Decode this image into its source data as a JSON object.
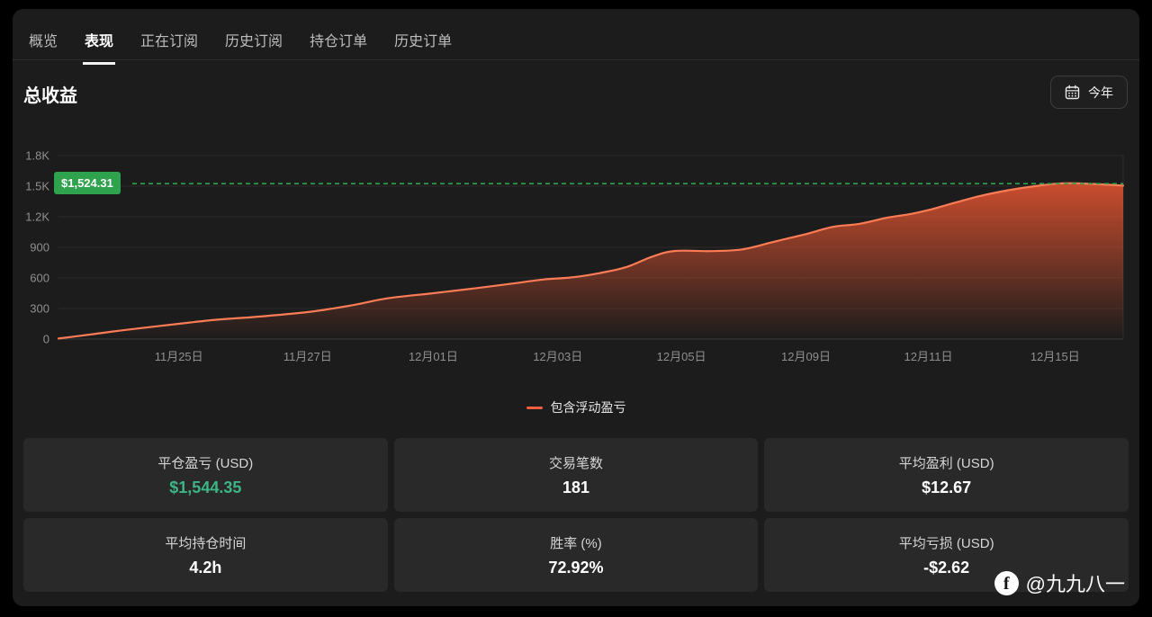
{
  "tabs": {
    "items": [
      {
        "label": "概览",
        "active": false
      },
      {
        "label": "表现",
        "active": true
      },
      {
        "label": "正在订阅",
        "active": false
      },
      {
        "label": "历史订阅",
        "active": false
      },
      {
        "label": "持仓订单",
        "active": false
      },
      {
        "label": "历史订单",
        "active": false
      }
    ]
  },
  "header": {
    "title": "总收益",
    "range_button": "今年"
  },
  "chart_data": {
    "type": "area",
    "title": "总收益",
    "unit": "USD",
    "ylim": [
      0,
      1800
    ],
    "grid": true,
    "y_ticks": [
      "0",
      "300",
      "600",
      "900",
      "1.2K",
      "1.5K",
      "1.8K"
    ],
    "y_tick_values": [
      0,
      300,
      600,
      900,
      1200,
      1500,
      1800
    ],
    "x_ticks": [
      "11月25日",
      "11月27日",
      "12月01日",
      "12月03日",
      "12月05日",
      "12月09日",
      "12月11日",
      "12月15日"
    ],
    "x_tick_fracs": [
      0.113,
      0.234,
      0.352,
      0.469,
      0.585,
      0.702,
      0.817,
      0.936
    ],
    "marker": {
      "label": "$1,524.31",
      "value": 1524.31
    },
    "legend_position": "bottom-center",
    "series": [
      {
        "name": "包含浮动盈亏",
        "points": [
          [
            0.0,
            5
          ],
          [
            0.03,
            45
          ],
          [
            0.063,
            90
          ],
          [
            0.113,
            150
          ],
          [
            0.148,
            190
          ],
          [
            0.182,
            215
          ],
          [
            0.234,
            265
          ],
          [
            0.275,
            330
          ],
          [
            0.309,
            400
          ],
          [
            0.352,
            450
          ],
          [
            0.393,
            500
          ],
          [
            0.427,
            545
          ],
          [
            0.456,
            585
          ],
          [
            0.482,
            605
          ],
          [
            0.507,
            645
          ],
          [
            0.533,
            705
          ],
          [
            0.558,
            810
          ],
          [
            0.579,
            865
          ],
          [
            0.613,
            863
          ],
          [
            0.642,
            880
          ],
          [
            0.672,
            955
          ],
          [
            0.702,
            1030
          ],
          [
            0.727,
            1100
          ],
          [
            0.752,
            1130
          ],
          [
            0.778,
            1190
          ],
          [
            0.799,
            1225
          ],
          [
            0.817,
            1265
          ],
          [
            0.841,
            1335
          ],
          [
            0.866,
            1405
          ],
          [
            0.892,
            1460
          ],
          [
            0.917,
            1500
          ],
          [
            0.943,
            1528
          ],
          [
            0.972,
            1522
          ],
          [
            1.0,
            1505
          ]
        ]
      }
    ]
  },
  "legend": {
    "label": "包含浮动盈亏"
  },
  "stats": {
    "cards": [
      {
        "label": "平仓盈亏 (USD)",
        "value": "$1,544.35",
        "positive": true
      },
      {
        "label": "交易笔数",
        "value": "181",
        "positive": false
      },
      {
        "label": "平均盈利 (USD)",
        "value": "$12.67",
        "positive": false
      },
      {
        "label": "平均持仓时间",
        "value": "4.2h",
        "positive": false
      },
      {
        "label": "胜率 (%)",
        "value": "72.92%",
        "positive": false
      },
      {
        "label": "平均亏损 (USD)",
        "value": "-$2.62",
        "positive": false
      }
    ]
  },
  "watermark": {
    "handle": "@九九八一",
    "icon": "facebook-icon"
  },
  "colors": {
    "line_orange": "#fb7c55",
    "area_orange": "#e05330",
    "legend_orange": "#f0603e",
    "marker_green": "#2fa24e",
    "positive_green": "#3db586",
    "tick_gray": "#8f8f8f",
    "gridline": "#2a2a2a"
  }
}
